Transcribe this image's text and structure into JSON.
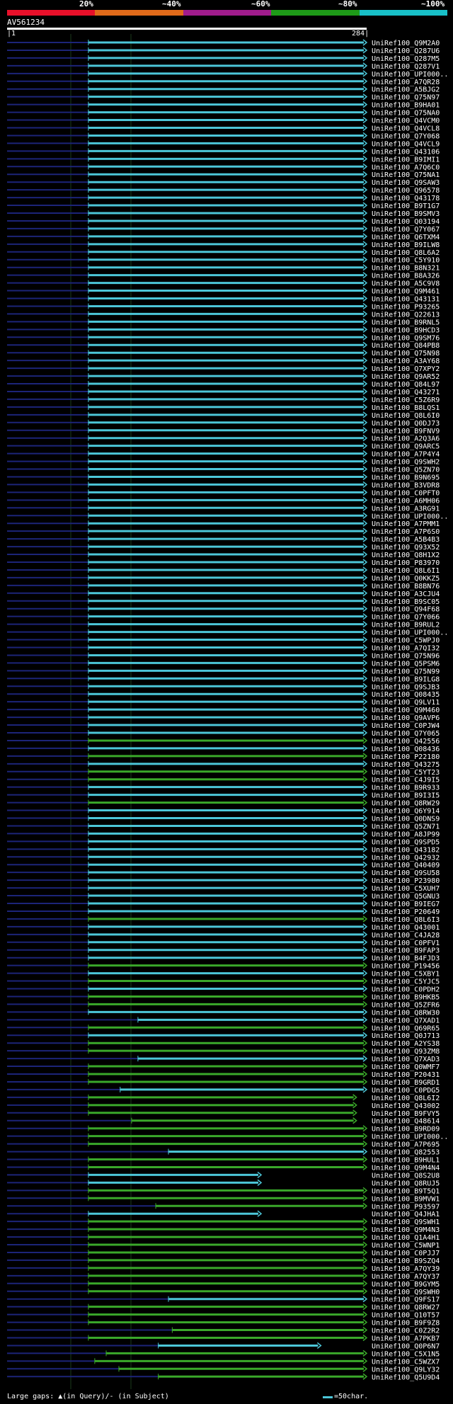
{
  "header": {
    "percent_labels": [
      "20%",
      "~40%",
      "~60%",
      "~80%",
      "~100%"
    ],
    "segment_colors": [
      "#e8102a",
      "#e06a1a",
      "#a01c8c",
      "#1e9a18",
      "#18c0c8"
    ]
  },
  "query": {
    "name": "AV561234",
    "start": "1",
    "end": "284"
  },
  "colors": {
    "cyan": "#4cc6d8",
    "green": "#3aa82a",
    "query_line": "#ffffff",
    "left_bar": "#1c2478",
    "marker": "#ffffa0"
  },
  "hits": [
    {
      "id": "UniRef100_Q9M2A0",
      "color": "cyan",
      "start": 65,
      "end": 284
    },
    {
      "id": "UniRef100_Q287U6",
      "color": "cyan",
      "start": 65,
      "end": 284
    },
    {
      "id": "UniRef100_Q287M5",
      "color": "cyan",
      "start": 65,
      "end": 284
    },
    {
      "id": "UniRef100_Q287V1",
      "color": "cyan",
      "start": 65,
      "end": 284
    },
    {
      "id": "UniRef100_UPI000..",
      "color": "cyan",
      "start": 65,
      "end": 284
    },
    {
      "id": "UniRef100_A7QR28",
      "color": "cyan",
      "start": 65,
      "end": 284
    },
    {
      "id": "UniRef100_A5BJG2",
      "color": "cyan",
      "start": 65,
      "end": 284
    },
    {
      "id": "UniRef100_Q75N97",
      "color": "cyan",
      "start": 65,
      "end": 284
    },
    {
      "id": "UniRef100_B9HA01",
      "color": "cyan",
      "start": 65,
      "end": 284
    },
    {
      "id": "UniRef100_Q75NA0",
      "color": "cyan",
      "start": 65,
      "end": 284
    },
    {
      "id": "UniRef100_Q4VCM0",
      "color": "cyan",
      "start": 65,
      "end": 284
    },
    {
      "id": "UniRef100_Q4VCL8",
      "color": "cyan",
      "start": 65,
      "end": 284
    },
    {
      "id": "UniRef100_Q7Y068",
      "color": "cyan",
      "start": 65,
      "end": 284
    },
    {
      "id": "UniRef100_Q4VCL9",
      "color": "cyan",
      "start": 65,
      "end": 284
    },
    {
      "id": "UniRef100_Q43106",
      "color": "cyan",
      "start": 65,
      "end": 284
    },
    {
      "id": "UniRef100_B9IMI1",
      "color": "cyan",
      "start": 65,
      "end": 284
    },
    {
      "id": "UniRef100_A7Q6C0",
      "color": "cyan",
      "start": 65,
      "end": 284
    },
    {
      "id": "UniRef100_Q75NA1",
      "color": "cyan",
      "start": 65,
      "end": 284
    },
    {
      "id": "UniRef100_Q9SAW3",
      "color": "cyan",
      "start": 65,
      "end": 284
    },
    {
      "id": "UniRef100_Q96578",
      "color": "cyan",
      "start": 65,
      "end": 284
    },
    {
      "id": "UniRef100_Q43178",
      "color": "cyan",
      "start": 65,
      "end": 284
    },
    {
      "id": "UniRef100_B9T1G7",
      "color": "cyan",
      "start": 65,
      "end": 284
    },
    {
      "id": "UniRef100_B9SMV3",
      "color": "cyan",
      "start": 65,
      "end": 284
    },
    {
      "id": "UniRef100_Q03194",
      "color": "cyan",
      "start": 65,
      "end": 284
    },
    {
      "id": "UniRef100_Q7Y067",
      "color": "cyan",
      "start": 65,
      "end": 284
    },
    {
      "id": "UniRef100_Q6TXM4",
      "color": "cyan",
      "start": 65,
      "end": 284
    },
    {
      "id": "UniRef100_B9ILW8",
      "color": "cyan",
      "start": 65,
      "end": 284
    },
    {
      "id": "UniRef100_Q8L6A2",
      "color": "cyan",
      "start": 65,
      "end": 284
    },
    {
      "id": "UniRef100_C5Y910",
      "color": "cyan",
      "start": 65,
      "end": 284
    },
    {
      "id": "UniRef100_B8N321",
      "color": "cyan",
      "start": 65,
      "end": 284
    },
    {
      "id": "UniRef100_B8A326",
      "color": "cyan",
      "start": 65,
      "end": 284
    },
    {
      "id": "UniRef100_A5C9V8",
      "color": "cyan",
      "start": 65,
      "end": 284
    },
    {
      "id": "UniRef100_Q9M461",
      "color": "cyan",
      "start": 65,
      "end": 284
    },
    {
      "id": "UniRef100_Q43131",
      "color": "cyan",
      "start": 65,
      "end": 284
    },
    {
      "id": "UniRef100_P93265",
      "color": "cyan",
      "start": 65,
      "end": 284
    },
    {
      "id": "UniRef100_Q22613",
      "color": "cyan",
      "start": 65,
      "end": 284
    },
    {
      "id": "UniRef100_B9RNL5",
      "color": "cyan",
      "start": 65,
      "end": 284
    },
    {
      "id": "UniRef100_B9HCD3",
      "color": "cyan",
      "start": 65,
      "end": 284
    },
    {
      "id": "UniRef100_Q9SM76",
      "color": "cyan",
      "start": 65,
      "end": 284
    },
    {
      "id": "UniRef100_Q84PB8",
      "color": "cyan",
      "start": 65,
      "end": 284
    },
    {
      "id": "UniRef100_Q75N98",
      "color": "cyan",
      "start": 65,
      "end": 284
    },
    {
      "id": "UniRef100_A3AY68",
      "color": "cyan",
      "start": 65,
      "end": 284
    },
    {
      "id": "UniRef100_Q7XPY2",
      "color": "cyan",
      "start": 65,
      "end": 284
    },
    {
      "id": "UniRef100_Q9AR52",
      "color": "cyan",
      "start": 65,
      "end": 284
    },
    {
      "id": "UniRef100_Q84L97",
      "color": "cyan",
      "start": 65,
      "end": 284
    },
    {
      "id": "UniRef100_Q43271",
      "color": "cyan",
      "start": 65,
      "end": 284
    },
    {
      "id": "UniRef100_C5Z6R9",
      "color": "cyan",
      "start": 65,
      "end": 284
    },
    {
      "id": "UniRef100_B8LQS1",
      "color": "cyan",
      "start": 65,
      "end": 284
    },
    {
      "id": "UniRef100_Q8L6I0",
      "color": "cyan",
      "start": 65,
      "end": 284
    },
    {
      "id": "UniRef100_Q0DJ73",
      "color": "cyan",
      "start": 65,
      "end": 284
    },
    {
      "id": "UniRef100_B9FNV9",
      "color": "cyan",
      "start": 65,
      "end": 284
    },
    {
      "id": "UniRef100_A2Q3A6",
      "color": "cyan",
      "start": 65,
      "end": 284
    },
    {
      "id": "UniRef100_Q9ARC5",
      "color": "cyan",
      "start": 65,
      "end": 284
    },
    {
      "id": "UniRef100_A7P4Y4",
      "color": "cyan",
      "start": 65,
      "end": 284
    },
    {
      "id": "UniRef100_Q9SWH2",
      "color": "cyan",
      "start": 65,
      "end": 284
    },
    {
      "id": "UniRef100_Q5ZN70",
      "color": "cyan",
      "start": 65,
      "end": 284
    },
    {
      "id": "UniRef100_B9N695",
      "color": "cyan",
      "start": 65,
      "end": 284
    },
    {
      "id": "UniRef100_B3VDR8",
      "color": "cyan",
      "start": 65,
      "end": 284
    },
    {
      "id": "UniRef100_C0PFT0",
      "color": "cyan",
      "start": 65,
      "end": 284
    },
    {
      "id": "UniRef100_A6MH06",
      "color": "cyan",
      "start": 65,
      "end": 284
    },
    {
      "id": "UniRef100_A3RG91",
      "color": "cyan",
      "start": 65,
      "end": 284
    },
    {
      "id": "UniRef100_UPI000..",
      "color": "cyan",
      "start": 65,
      "end": 284
    },
    {
      "id": "UniRef100_A7PMM1",
      "color": "cyan",
      "start": 65,
      "end": 284
    },
    {
      "id": "UniRef100_A7P6S0",
      "color": "cyan",
      "start": 65,
      "end": 284
    },
    {
      "id": "UniRef100_A5B4B3",
      "color": "cyan",
      "start": 65,
      "end": 284
    },
    {
      "id": "UniRef100_Q93X52",
      "color": "cyan",
      "start": 65,
      "end": 284
    },
    {
      "id": "UniRef100_Q8H1X2",
      "color": "cyan",
      "start": 65,
      "end": 284
    },
    {
      "id": "UniRef100_P83970",
      "color": "cyan",
      "start": 65,
      "end": 284
    },
    {
      "id": "UniRef100_Q8L6I1",
      "color": "cyan",
      "start": 65,
      "end": 284
    },
    {
      "id": "UniRef100_Q0KKZ5",
      "color": "cyan",
      "start": 65,
      "end": 284
    },
    {
      "id": "UniRef100_B8BN76",
      "color": "cyan",
      "start": 65,
      "end": 284
    },
    {
      "id": "UniRef100_A3CJU4",
      "color": "cyan",
      "start": 65,
      "end": 284
    },
    {
      "id": "UniRef100_B9SC05",
      "color": "cyan",
      "start": 65,
      "end": 284
    },
    {
      "id": "UniRef100_Q94F68",
      "color": "cyan",
      "start": 65,
      "end": 284
    },
    {
      "id": "UniRef100_Q7Y066",
      "color": "cyan",
      "start": 65,
      "end": 284
    },
    {
      "id": "UniRef100_B9RUL2",
      "color": "cyan",
      "start": 65,
      "end": 284
    },
    {
      "id": "UniRef100_UPI000..",
      "color": "cyan",
      "start": 65,
      "end": 284
    },
    {
      "id": "UniRef100_C5WPJ0",
      "color": "cyan",
      "start": 65,
      "end": 284
    },
    {
      "id": "UniRef100_A7QI32",
      "color": "cyan",
      "start": 65,
      "end": 284
    },
    {
      "id": "UniRef100_Q75N96",
      "color": "cyan",
      "start": 65,
      "end": 284
    },
    {
      "id": "UniRef100_Q5PSM6",
      "color": "cyan",
      "start": 65,
      "end": 284
    },
    {
      "id": "UniRef100_Q75N99",
      "color": "cyan",
      "start": 65,
      "end": 284
    },
    {
      "id": "UniRef100_B9ILG8",
      "color": "cyan",
      "start": 65,
      "end": 284
    },
    {
      "id": "UniRef100_Q9SJB3",
      "color": "cyan",
      "start": 65,
      "end": 284
    },
    {
      "id": "UniRef100_Q08435",
      "color": "cyan",
      "start": 65,
      "end": 284
    },
    {
      "id": "UniRef100_Q9LV11",
      "color": "cyan",
      "start": 65,
      "end": 284
    },
    {
      "id": "UniRef100_Q9M460",
      "color": "cyan",
      "start": 65,
      "end": 284
    },
    {
      "id": "UniRef100_Q9AVP6",
      "color": "cyan",
      "start": 65,
      "end": 284
    },
    {
      "id": "UniRef100_C0PJW4",
      "color": "cyan",
      "start": 65,
      "end": 284
    },
    {
      "id": "UniRef100_Q7Y065",
      "color": "cyan",
      "start": 65,
      "end": 284
    },
    {
      "id": "UniRef100_Q42556",
      "color": "green",
      "start": 65,
      "end": 284
    },
    {
      "id": "UniRef100_Q08436",
      "color": "cyan",
      "start": 65,
      "end": 284
    },
    {
      "id": "UniRef100_P22180",
      "color": "green",
      "start": 65,
      "end": 284
    },
    {
      "id": "UniRef100_Q43275",
      "color": "cyan",
      "start": 65,
      "end": 284
    },
    {
      "id": "UniRef100_C5YT23",
      "color": "green",
      "start": 65,
      "end": 284
    },
    {
      "id": "UniRef100_C4J9I5",
      "color": "green",
      "start": 65,
      "end": 284
    },
    {
      "id": "UniRef100_B9R933",
      "color": "cyan",
      "start": 65,
      "end": 284
    },
    {
      "id": "UniRef100_B9I3I5",
      "color": "cyan",
      "start": 65,
      "end": 284
    },
    {
      "id": "UniRef100_Q8RW29",
      "color": "green",
      "start": 65,
      "end": 284
    },
    {
      "id": "UniRef100_Q6Y914",
      "color": "cyan",
      "start": 65,
      "end": 284
    },
    {
      "id": "UniRef100_Q0DNS9",
      "color": "cyan",
      "start": 65,
      "end": 284
    },
    {
      "id": "UniRef100_Q5ZN71",
      "color": "cyan",
      "start": 65,
      "end": 284
    },
    {
      "id": "UniRef100_A8JP99",
      "color": "cyan",
      "start": 65,
      "end": 284
    },
    {
      "id": "UniRef100_Q9SPD5",
      "color": "cyan",
      "start": 65,
      "end": 284
    },
    {
      "id": "UniRef100_Q43182",
      "color": "cyan",
      "start": 65,
      "end": 284
    },
    {
      "id": "UniRef100_Q42932",
      "color": "cyan",
      "start": 65,
      "end": 284
    },
    {
      "id": "UniRef100_Q40409",
      "color": "cyan",
      "start": 65,
      "end": 284
    },
    {
      "id": "UniRef100_Q9SU58",
      "color": "cyan",
      "start": 65,
      "end": 284
    },
    {
      "id": "UniRef100_P23980",
      "color": "cyan",
      "start": 65,
      "end": 284
    },
    {
      "id": "UniRef100_C5XUH7",
      "color": "cyan",
      "start": 65,
      "end": 284
    },
    {
      "id": "UniRef100_Q5GNU3",
      "color": "cyan",
      "start": 65,
      "end": 284
    },
    {
      "id": "UniRef100_B9IEG7",
      "color": "cyan",
      "start": 65,
      "end": 284
    },
    {
      "id": "UniRef100_P20649",
      "color": "cyan",
      "start": 65,
      "end": 284
    },
    {
      "id": "UniRef100_Q8L6I3",
      "color": "green",
      "start": 65,
      "end": 284
    },
    {
      "id": "UniRef100_Q43001",
      "color": "cyan",
      "start": 65,
      "end": 284
    },
    {
      "id": "UniRef100_C4JA28",
      "color": "cyan",
      "start": 65,
      "end": 284
    },
    {
      "id": "UniRef100_C0PFV1",
      "color": "cyan",
      "start": 65,
      "end": 284
    },
    {
      "id": "UniRef100_B9FAP3",
      "color": "cyan",
      "start": 65,
      "end": 284
    },
    {
      "id": "UniRef100_B4FJD3",
      "color": "cyan",
      "start": 65,
      "end": 284
    },
    {
      "id": "UniRef100_P19456",
      "color": "green",
      "start": 65,
      "end": 284
    },
    {
      "id": "UniRef100_C5XBY1",
      "color": "cyan",
      "start": 65,
      "end": 284
    },
    {
      "id": "UniRef100_C5YJC5",
      "color": "green",
      "start": 65,
      "end": 284
    },
    {
      "id": "UniRef100_C0PDH2",
      "color": "cyan",
      "start": 65,
      "end": 284
    },
    {
      "id": "UniRef100_B9HKB5",
      "color": "green",
      "start": 65,
      "end": 284
    },
    {
      "id": "UniRef100_Q5ZFR6",
      "color": "green",
      "start": 65,
      "end": 284
    },
    {
      "id": "UniRef100_Q8RW30",
      "color": "cyan",
      "start": 65,
      "end": 284
    },
    {
      "id": "UniRef100_Q7XAD1",
      "color": "cyan",
      "start": 104,
      "end": 284
    },
    {
      "id": "UniRef100_Q69R65",
      "color": "green",
      "start": 65,
      "end": 284
    },
    {
      "id": "UniRef100_Q0J713",
      "color": "cyan",
      "start": 65,
      "end": 284
    },
    {
      "id": "UniRef100_A2YS38",
      "color": "green",
      "start": 65,
      "end": 284
    },
    {
      "id": "UniRef100_Q93ZM8",
      "color": "green",
      "start": 65,
      "end": 284
    },
    {
      "id": "UniRef100_Q7XAD3",
      "color": "cyan",
      "start": 104,
      "end": 284
    },
    {
      "id": "UniRef100_Q0WMF7",
      "color": "green",
      "start": 65,
      "end": 284
    },
    {
      "id": "UniRef100_P20431",
      "color": "green",
      "start": 65,
      "end": 284
    },
    {
      "id": "UniRef100_B9GRD1",
      "color": "green",
      "start": 65,
      "end": 284
    },
    {
      "id": "UniRef100_C0PDG5",
      "color": "cyan",
      "start": 90,
      "end": 284
    },
    {
      "id": "UniRef100_Q8L6I2",
      "color": "green",
      "start": 65,
      "end": 276
    },
    {
      "id": "UniRef100_Q43002",
      "color": "green",
      "start": 65,
      "end": 276
    },
    {
      "id": "UniRef100_B9FVY5",
      "color": "green",
      "start": 65,
      "end": 276
    },
    {
      "id": "UniRef100_Q48614",
      "color": "green",
      "start": 99,
      "end": 276
    },
    {
      "id": "UniRef100_B9RD09",
      "color": "green",
      "start": 65,
      "end": 284
    },
    {
      "id": "UniRef100_UPI000..",
      "color": "green",
      "start": 65,
      "end": 284
    },
    {
      "id": "UniRef100_A7P695",
      "color": "green",
      "start": 65,
      "end": 284
    },
    {
      "id": "UniRef100_Q82553",
      "color": "cyan",
      "start": 128,
      "end": 284
    },
    {
      "id": "UniRef100_B9HUL1",
      "color": "green",
      "start": 65,
      "end": 284
    },
    {
      "id": "UniRef100_Q9M4N4",
      "color": "green",
      "start": 65,
      "end": 284
    },
    {
      "id": "UniRef100_Q8S2U8",
      "color": "cyan",
      "start": 65,
      "end": 201
    },
    {
      "id": "UniRef100_Q8RUJ5",
      "color": "cyan",
      "start": 65,
      "end": 201
    },
    {
      "id": "UniRef100_B9T5Q1",
      "color": "green",
      "start": 65,
      "end": 284
    },
    {
      "id": "UniRef100_B9MVW1",
      "color": "green",
      "start": 65,
      "end": 284
    },
    {
      "id": "UniRef100_P93597",
      "color": "green",
      "start": 118,
      "end": 284
    },
    {
      "id": "UniRef100_Q4JHA1",
      "color": "cyan",
      "start": 65,
      "end": 201
    },
    {
      "id": "UniRef100_Q9SWH1",
      "color": "green",
      "start": 65,
      "end": 284
    },
    {
      "id": "UniRef100_Q9M4N3",
      "color": "green",
      "start": 65,
      "end": 284
    },
    {
      "id": "UniRef100_Q1A4H1",
      "color": "green",
      "start": 65,
      "end": 284
    },
    {
      "id": "UniRef100_C5WNP1",
      "color": "green",
      "start": 65,
      "end": 284
    },
    {
      "id": "UniRef100_C0PJJ7",
      "color": "green",
      "start": 65,
      "end": 284
    },
    {
      "id": "UniRef100_B9SZQ4",
      "color": "green",
      "start": 65,
      "end": 284
    },
    {
      "id": "UniRef100_A7QY39",
      "color": "green",
      "start": 65,
      "end": 284
    },
    {
      "id": "UniRef100_A7QY37",
      "color": "green",
      "start": 65,
      "end": 284
    },
    {
      "id": "UniRef100_B9GYM5",
      "color": "green",
      "start": 65,
      "end": 284
    },
    {
      "id": "UniRef100_Q9SWH0",
      "color": "green",
      "start": 65,
      "end": 284
    },
    {
      "id": "UniRef100_Q9FS17",
      "color": "cyan",
      "start": 128,
      "end": 284
    },
    {
      "id": "UniRef100_Q8RW27",
      "color": "green",
      "start": 65,
      "end": 284
    },
    {
      "id": "UniRef100_Q10T57",
      "color": "green",
      "start": 65,
      "end": 284
    },
    {
      "id": "UniRef100_B9F9Z8",
      "color": "green",
      "start": 65,
      "end": 284
    },
    {
      "id": "UniRef100_C0Z2R2",
      "color": "green",
      "start": 131,
      "end": 284
    },
    {
      "id": "UniRef100_A7PKB7",
      "color": "green",
      "start": 65,
      "end": 284
    },
    {
      "id": "UniRef100_Q0P6N7",
      "color": "cyan",
      "start": 120,
      "end": 248
    },
    {
      "id": "UniRef100_C5X1N5",
      "color": "green",
      "start": 79,
      "end": 284
    },
    {
      "id": "UniRef100_C5WZX7",
      "color": "green",
      "start": 70,
      "end": 284
    },
    {
      "id": "UniRef100_Q9LY32",
      "color": "green",
      "start": 89,
      "end": 284
    },
    {
      "id": "UniRef100_Q5U9D4",
      "color": "green",
      "start": 120,
      "end": 284
    }
  ],
  "footer": {
    "gap_legend": "Large gaps: ▲(in Query)/- (in Subject)",
    "scale_label": "=50char."
  }
}
